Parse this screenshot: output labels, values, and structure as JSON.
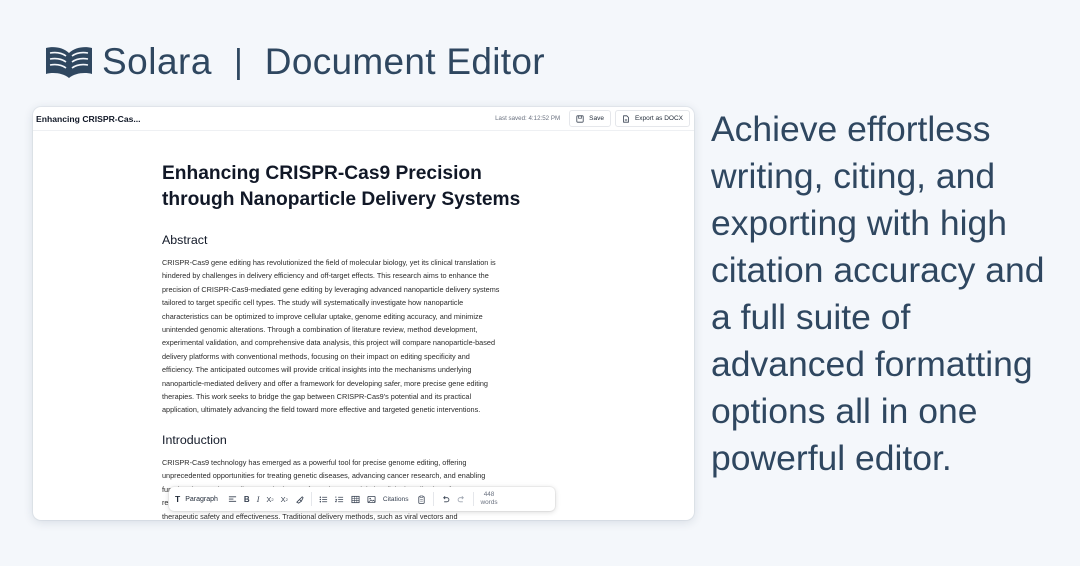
{
  "brand": {
    "name": "Solara",
    "separator": "|",
    "product": "Document Editor",
    "logo_icon": "open-book-icon",
    "color": "#2f4760"
  },
  "editor": {
    "tab_title": "Enhancing CRISPR-Cas...",
    "last_saved": "Last saved: 4:12:52 PM",
    "save_label": "Save",
    "export_label": "Export as DOCX",
    "document": {
      "title_line1": "Enhancing CRISPR-Cas9 Precision",
      "title_line2": "through Nanoparticle Delivery Systems",
      "sections": [
        {
          "heading": "Abstract",
          "lines": [
            "CRISPR-Cas9 gene editing has revolutionized the field of molecular biology, yet its clinical translation is",
            "hindered by challenges in delivery efficiency and off-target effects. This research aims to enhance the",
            "precision of CRISPR-Cas9-mediated gene editing by leveraging advanced nanoparticle delivery systems",
            "tailored to target specific cell types. The study will systematically investigate how nanoparticle",
            "characteristics can be optimized to improve cellular uptake, genome editing accuracy, and minimize",
            "unintended genomic alterations. Through a combination of literature review, method development,",
            "experimental validation, and comprehensive data analysis, this project will compare nanoparticle-based",
            "delivery platforms with conventional methods, focusing on their impact on editing specificity and",
            "efficiency. The anticipated outcomes will provide critical insights into the mechanisms underlying",
            "nanoparticle-mediated delivery and offer a framework for developing safer, more precise gene editing",
            "therapies. This work seeks to bridge the gap between CRISPR-Cas9's potential and its practical",
            "application, ultimately advancing the field toward more effective and targeted genetic interventions."
          ]
        },
        {
          "heading": "Introduction",
          "lines": [
            "CRISPR-Cas9 technology has emerged as a powerful tool for precise genome editing, offering",
            "unprecedented opportunities for treating genetic diseases, advancing cancer research, and enabling",
            "functional genomics studies. Despite its transformative potential, the clinical application of CRISPR-Cas9",
            "re",
            "therapeutic safety and effectiveness. Traditional delivery methods, such as viral vectors and"
          ]
        }
      ]
    },
    "toolbar": {
      "paragraph_label": "Paragraph",
      "citations_label": "Citations",
      "word_count": "448",
      "word_unit": "words"
    }
  },
  "tagline": [
    "Achieve effortless",
    "writing, citing, and",
    "exporting with high",
    "citation accuracy and",
    "a full suite of",
    "advanced formatting",
    "options all in one",
    "powerful editor."
  ]
}
